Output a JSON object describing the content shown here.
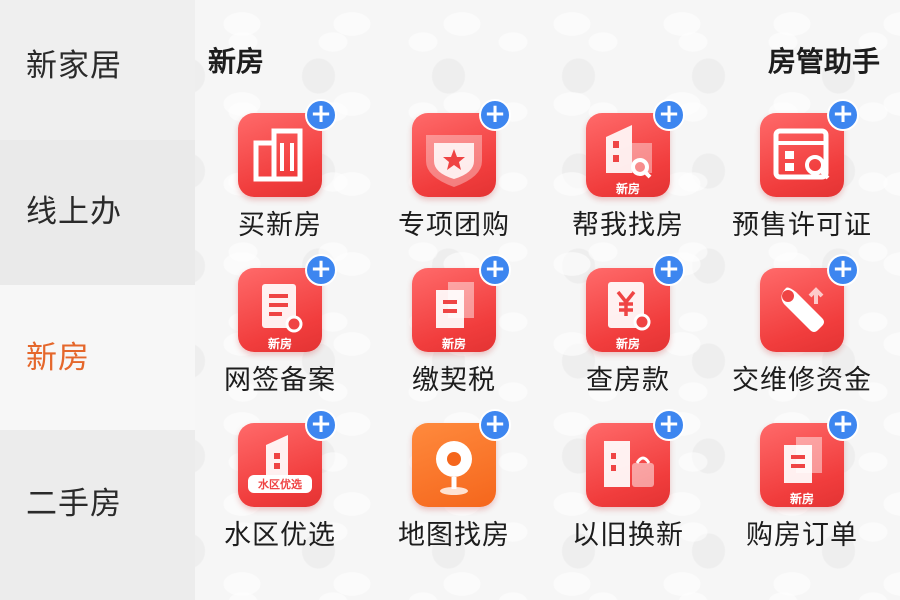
{
  "sidebar": {
    "items": [
      {
        "label": "新家居"
      },
      {
        "label": "线上办"
      },
      {
        "label": "新房"
      },
      {
        "label": "二手房"
      }
    ]
  },
  "main": {
    "section_title": "新房",
    "helper_link": "房管助手",
    "plus_symbol": "+",
    "tiles": [
      {
        "label": "买新房",
        "icon": "buildings-icon"
      },
      {
        "label": "专项团购",
        "icon": "shield-star-icon"
      },
      {
        "label": "帮我找房",
        "icon": "house-search-icon",
        "badge": "新房"
      },
      {
        "label": "预售许可证",
        "icon": "certificate-search-icon"
      },
      {
        "label": "网签备案",
        "icon": "document-seal-icon",
        "badge": "新房"
      },
      {
        "label": "缴契税",
        "icon": "documents-icon",
        "badge": "新房"
      },
      {
        "label": "查房款",
        "icon": "yen-document-icon",
        "badge": "新房"
      },
      {
        "label": "交维修资金",
        "icon": "wrench-icon"
      },
      {
        "label": "水区优选",
        "icon": "house-banner-icon",
        "badge": "水区优选"
      },
      {
        "label": "地图找房",
        "icon": "map-pin-icon"
      },
      {
        "label": "以旧换新",
        "icon": "house-bag-icon"
      },
      {
        "label": "购房订单",
        "icon": "order-documents-icon",
        "badge": "新房"
      }
    ]
  }
}
